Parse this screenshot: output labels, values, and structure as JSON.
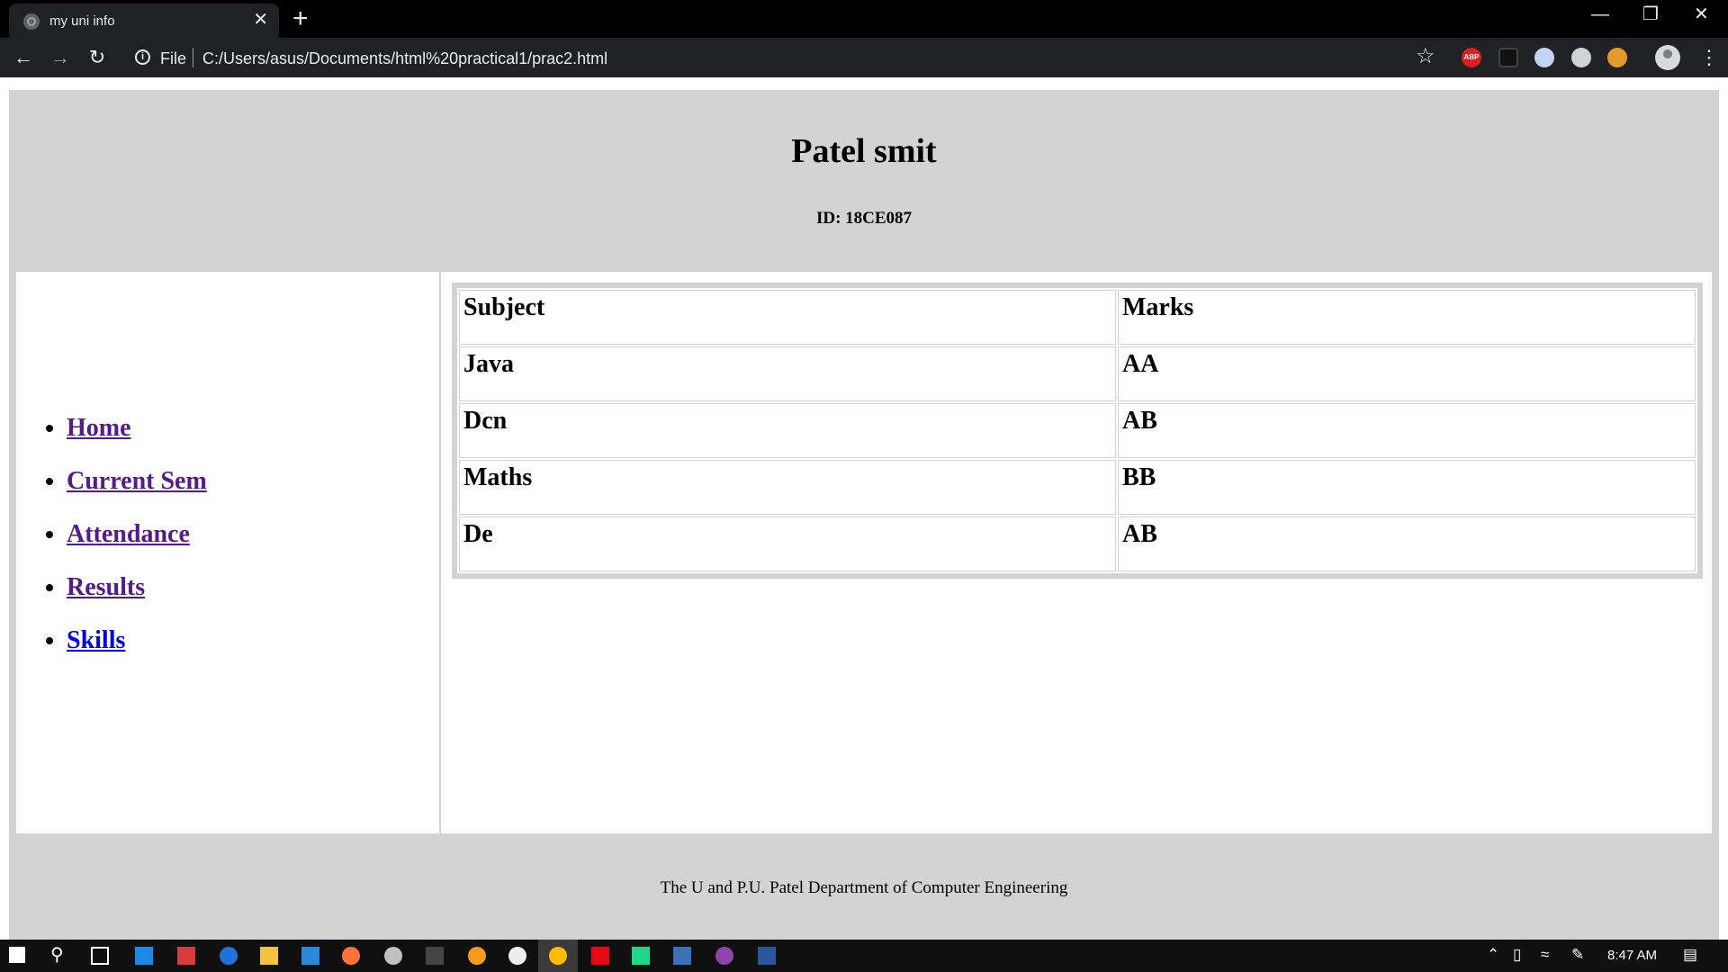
{
  "browser": {
    "tab_title": "my uni info",
    "tab_close": "✕",
    "new_tab": "+",
    "scheme": "File",
    "url": "C:/Users/asus/Documents/html%20practical1/prac2.html",
    "extensions": {
      "abp": "ABP"
    }
  },
  "header": {
    "name": "Patel smit",
    "id": "ID: 18CE087"
  },
  "sidebar": {
    "links": [
      {
        "label": "Home"
      },
      {
        "label": "Current Sem"
      },
      {
        "label": "Attendance"
      },
      {
        "label": "Results"
      },
      {
        "label": "Skills"
      }
    ]
  },
  "table": {
    "headers": [
      "Subject",
      "Marks"
    ],
    "rows": [
      [
        "Java",
        "AA"
      ],
      [
        "Dcn",
        "AB"
      ],
      [
        "Maths",
        "BB"
      ],
      [
        "De",
        "AB"
      ]
    ]
  },
  "footer": {
    "text": "The U and P.U. Patel Department of Computer Engineering"
  },
  "taskbar": {
    "time": "8:47 AM"
  }
}
